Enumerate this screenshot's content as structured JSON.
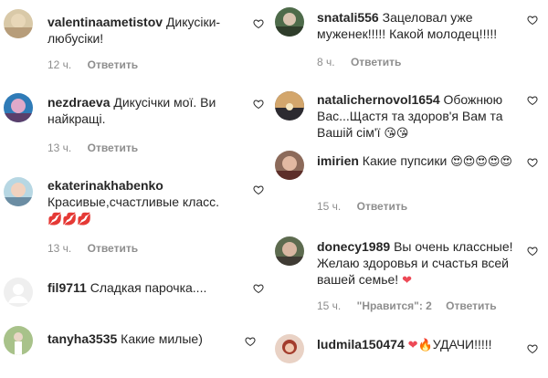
{
  "comments_left": [
    {
      "username": "valentinaametistov",
      "text": "Дикусіки-любусіки!",
      "time": "12 ч.",
      "reply": "Ответить"
    },
    {
      "username": "nezdraeva",
      "text": "Дикусічки мої. Ви найкращі.",
      "time": "13 ч.",
      "reply": "Ответить"
    },
    {
      "username": "ekaterinakhabenko",
      "text": "Красивые,счастливые класс.",
      "emoji": "💋💋💋",
      "time": "13 ч.",
      "reply": "Ответить"
    },
    {
      "username": "fil9711",
      "text": "Сладкая парочка....",
      "time": "",
      "reply": ""
    },
    {
      "username": "tanyha3535",
      "text": "Какие милые)",
      "time": "",
      "reply": ""
    }
  ],
  "comments_right": [
    {
      "username": "snatali556",
      "text": "Зацеловал уже муженек!!!!! Какой молодец!!!!!",
      "time": "8 ч.",
      "reply": "Ответить"
    },
    {
      "username": "natalichernovol1654",
      "text": "Обожнюю Вас...Щастя та здоров'я Вам та Вашій сім'ї",
      "emoji": "😘😘",
      "time": "",
      "reply": ""
    },
    {
      "username": "imirien",
      "text": "Какие пупсики",
      "emoji": "😍😍😍😍😍",
      "time": "15 ч.",
      "reply": "Ответить"
    },
    {
      "username": "donecy1989",
      "text": "Вы очень классные! Желаю здоровья и счастья всей вашей семье!",
      "emoji": "❤",
      "time": "15 ч.",
      "reply": "Ответить",
      "likes": "\"Нравится\": 2"
    },
    {
      "username": "ludmila150474",
      "text": "УДАЧИ!!!!!",
      "emoji_pre": "❤🔥",
      "time": "",
      "reply": ""
    }
  ],
  "icons": {
    "like": "heart-outline-icon"
  },
  "colors": {
    "text": "#262626",
    "meta": "#8e8e8e",
    "heart_red": "#ed4956"
  }
}
